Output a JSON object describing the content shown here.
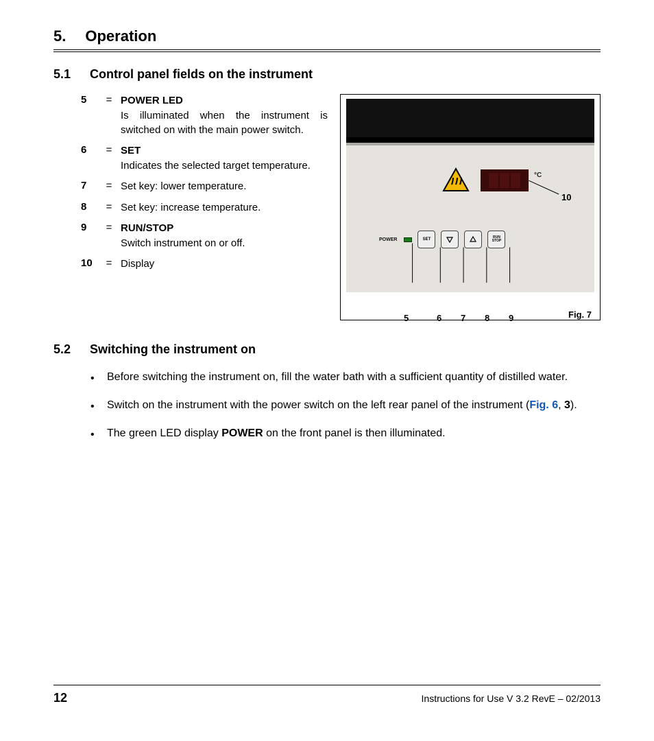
{
  "header": {
    "num": "5.",
    "title": "Operation"
  },
  "sub1": {
    "num": "5.1",
    "title": "Control panel fields on the instrument"
  },
  "defs": [
    {
      "n": "5",
      "term": "POWER LED",
      "desc": "Is illuminated when the instrument is switched on with the main power switch."
    },
    {
      "n": "6",
      "term": "SET",
      "desc": "Indicates the selected target temperature."
    },
    {
      "n": "7",
      "term": "",
      "desc": "Set key: lower temperature."
    },
    {
      "n": "8",
      "term": "",
      "desc": "Set key: increase temperature."
    },
    {
      "n": "9",
      "term": "RUN/STOP",
      "desc": "Switch instrument on or off."
    },
    {
      "n": "10",
      "term": "",
      "desc": "Display"
    }
  ],
  "figure": {
    "callouts": [
      "5",
      "6",
      "7",
      "8",
      "9",
      "10"
    ],
    "caption": "Fig. 7",
    "unit": "°C",
    "btn_set": "SET",
    "btn_run_top": "RUN",
    "btn_run_bot": "STOP",
    "power": "POWER"
  },
  "sub2": {
    "num": "5.2",
    "title": "Switching the instrument on"
  },
  "bullets": {
    "b1": "Before switching the instrument on, fill the water bath with a sufficient quantity of distilled water.",
    "b2a": "Switch on the instrument with the power switch on the left rear panel of the instrument (",
    "b2link": "Fig. 6",
    "b2b": ", ",
    "b2bold": "3",
    "b2c": ").",
    "b3a": "The green LED display ",
    "b3bold": "POWER",
    "b3b": " on the front panel is then illuminated."
  },
  "footer": {
    "page": "12",
    "text": "Instructions for Use V 3.2 RevE – 02/2013"
  }
}
